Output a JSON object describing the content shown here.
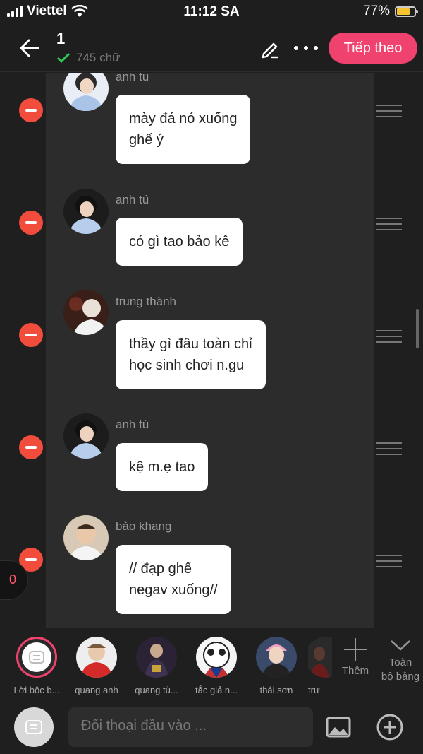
{
  "status_bar": {
    "carrier": "Viettel",
    "time": "11:12 SA",
    "battery": "77%",
    "battery_level": 0.77
  },
  "header": {
    "chapter": "1",
    "word_count": "745 chữ",
    "next_label": "Tiếp theo"
  },
  "messages": [
    {
      "name": "anh tú",
      "text": "mày đá nó xuống\nghế ý"
    },
    {
      "name": "anh tú",
      "text": "có gì tao bảo kê"
    },
    {
      "name": "trung thành",
      "text": "thầy gì đâu toàn chỉ\nhọc sinh chơi n.gu"
    },
    {
      "name": "anh tú",
      "text": "kệ m.ẹ tao"
    },
    {
      "name": "bảo khang",
      "text": "// đạp ghế\nnegav xuống//"
    }
  ],
  "counter": "0",
  "characters": [
    {
      "label": "Lời bộc b..."
    },
    {
      "label": "quang anh"
    },
    {
      "label": "quang tù..."
    },
    {
      "label": "tắc giả n..."
    },
    {
      "label": "thái sơn"
    },
    {
      "label": "trư"
    }
  ],
  "add_label": "Thêm",
  "board_label": "Toàn\nbộ bảng",
  "input": {
    "placeholder": "Đối thoại đầu vào ..."
  },
  "colors": {
    "accent": "#f0426e",
    "delete": "#f24c3d",
    "bubble": "#ffffff",
    "background": "#1f1f1f"
  }
}
